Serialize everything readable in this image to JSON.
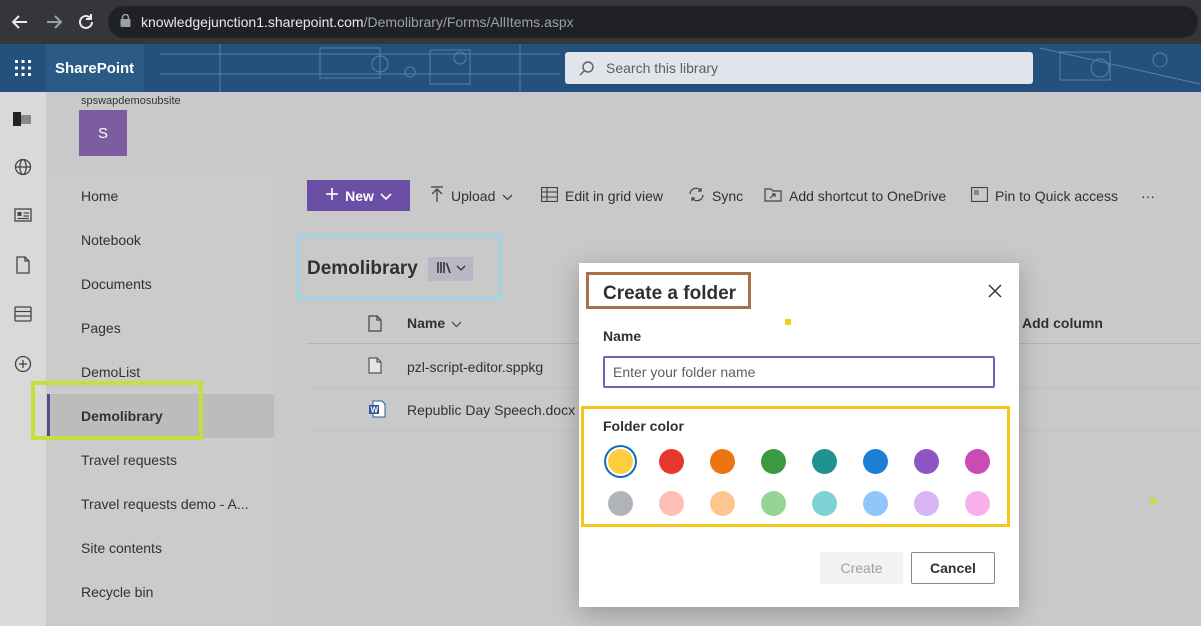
{
  "browser": {
    "url_host": "knowledgejunction1.sharepoint.com",
    "url_path": "/Demolibrary/Forms/AllItems.aspx"
  },
  "suite": {
    "brand": "SharePoint",
    "search_placeholder": "Search this library"
  },
  "site": {
    "name": "spswapdemosubsite",
    "logo_letter": "S"
  },
  "nav": {
    "items": [
      {
        "label": "Home"
      },
      {
        "label": "Notebook"
      },
      {
        "label": "Documents"
      },
      {
        "label": "Pages"
      },
      {
        "label": "DemoList"
      },
      {
        "label": "Demolibrary"
      },
      {
        "label": "Travel requests"
      },
      {
        "label": "Travel requests demo - A..."
      },
      {
        "label": "Site contents"
      },
      {
        "label": "Recycle bin"
      }
    ]
  },
  "commands": {
    "new": "New",
    "upload": "Upload",
    "grid": "Edit in grid view",
    "sync": "Sync",
    "shortcut": "Add shortcut to OneDrive",
    "pin": "Pin to Quick access",
    "more": "···"
  },
  "library": {
    "title": "Demolibrary",
    "col_name": "Name",
    "col_add": "Add column",
    "files": [
      {
        "name": "pzl-script-editor.sppkg"
      },
      {
        "name": "Republic Day Speech.docx"
      }
    ]
  },
  "dialog": {
    "title": "Create a folder",
    "name_label": "Name",
    "name_placeholder": "Enter your folder name",
    "color_label": "Folder color",
    "colors": [
      "#ffcd40",
      "#e5372c",
      "#ec7411",
      "#3a9a3f",
      "#1e9390",
      "#1c7fd6",
      "#8e53c5",
      "#c94bb3",
      "#b0b4b8",
      "#ffbdb7",
      "#ffc58f",
      "#94d597",
      "#7dd3d3",
      "#90c6f9",
      "#d7b5f6",
      "#f8b0ea"
    ],
    "selected_color_index": 0,
    "create": "Create",
    "cancel": "Cancel"
  }
}
